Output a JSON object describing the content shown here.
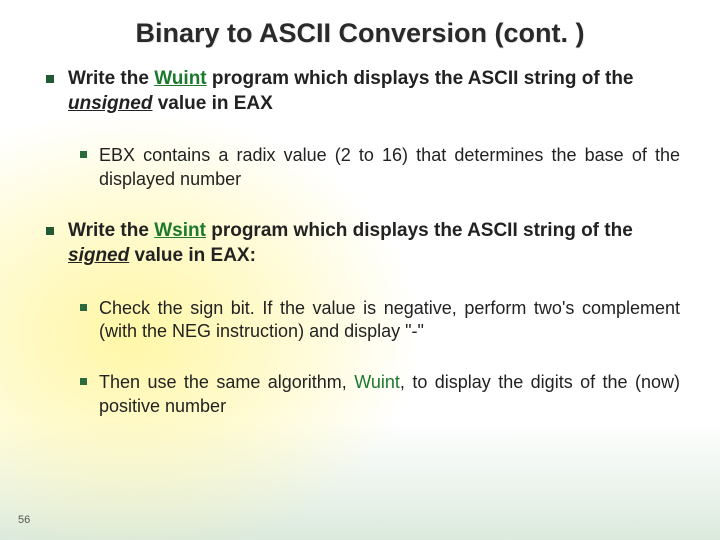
{
  "title": "Binary to ASCII Conversion (cont. )",
  "bullets": {
    "b1": {
      "pre": "Write the ",
      "prog": "Wuint",
      "mid": " program which displays the ASCII string of the ",
      "emph": "unsigned",
      "post": " value in EAX"
    },
    "b1a": "EBX contains a radix value (2 to 16) that determines the base of the displayed number",
    "b2": {
      "pre": "Write the ",
      "prog": "Wsint",
      "mid": " program which displays the ASCII string of the ",
      "emph": "signed",
      "post": " value in EAX:"
    },
    "b2a": "Check the sign bit. If the value is negative, perform two's complement (with the NEG instruction) and display \"-\"",
    "b2b": {
      "pre": "Then use the same algorithm, ",
      "prog": "Wuint",
      "post": ", to display the digits of the (now) positive number"
    }
  },
  "page_number": "56"
}
